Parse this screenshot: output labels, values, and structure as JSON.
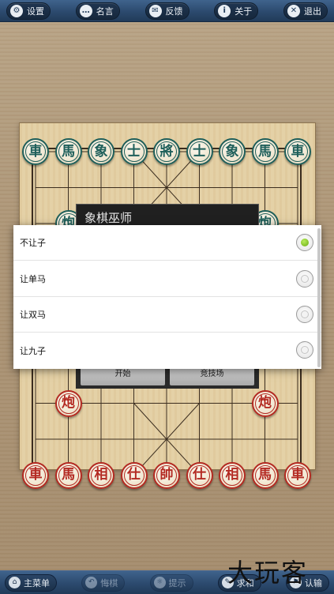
{
  "top_toolbar": {
    "buttons": [
      {
        "label": "设置",
        "icon": "gear-icon",
        "glyph": "⚙"
      },
      {
        "label": "名言",
        "icon": "speech-bubble-icon",
        "glyph": "…"
      },
      {
        "label": "反馈",
        "icon": "envelope-icon",
        "glyph": "✉"
      },
      {
        "label": "关于",
        "icon": "info-icon",
        "glyph": "i"
      },
      {
        "label": "退出",
        "icon": "close-icon",
        "glyph": "✕"
      }
    ]
  },
  "board": {
    "black_back_row": [
      "車",
      "馬",
      "象",
      "士",
      "將",
      "士",
      "象",
      "馬",
      "車"
    ],
    "black_cannons": [
      "炮",
      "炮"
    ],
    "red_cannons": [
      "炮",
      "炮"
    ],
    "red_back_row": [
      "車",
      "馬",
      "相",
      "仕",
      "帥",
      "仕",
      "相",
      "馬",
      "車"
    ],
    "colors": {
      "black_piece": "#1f5f5a",
      "red_piece": "#b32a22",
      "board": "#e3cfa3",
      "line": "#3b2d1f"
    }
  },
  "background_dialog": {
    "title": "象棋巫师",
    "buttons": [
      "开始",
      "竞技场"
    ]
  },
  "handicap_dialog": {
    "options": [
      {
        "label": "不让子",
        "selected": true
      },
      {
        "label": "让单马",
        "selected": false
      },
      {
        "label": "让双马",
        "selected": false
      },
      {
        "label": "让九子",
        "selected": false
      }
    ],
    "accent": "#7cbb1e"
  },
  "bottom_toolbar": {
    "buttons": [
      {
        "label": "主菜单",
        "icon": "home-icon",
        "glyph": "⌂",
        "enabled": true
      },
      {
        "label": "悔棋",
        "icon": "undo-icon",
        "glyph": "↶",
        "enabled": false
      },
      {
        "label": "提示",
        "icon": "bulb-icon",
        "glyph": "☼",
        "enabled": false
      },
      {
        "label": "求和",
        "icon": "pencil-icon",
        "glyph": "✎",
        "enabled": true
      },
      {
        "label": "认输",
        "icon": "flag-icon",
        "glyph": "⚑",
        "enabled": true
      }
    ]
  },
  "watermark": "大玩客"
}
